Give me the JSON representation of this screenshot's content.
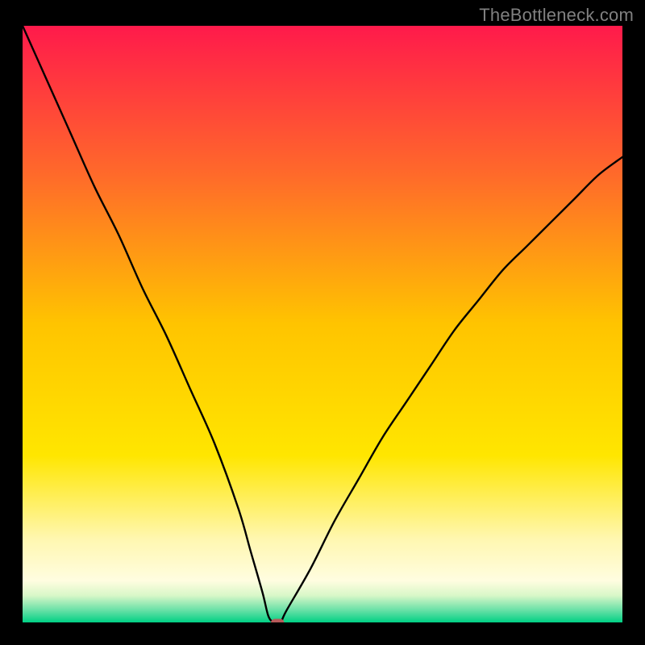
{
  "watermark": "TheBottleneck.com",
  "chart_data": {
    "type": "line",
    "title": "",
    "xlabel": "",
    "ylabel": "",
    "xlim": [
      0,
      100
    ],
    "ylim": [
      0,
      100
    ],
    "grid": false,
    "legend": false,
    "background": {
      "type": "vertical-gradient",
      "stops": [
        {
          "offset": 0.0,
          "color": "#ff1a4b"
        },
        {
          "offset": 0.25,
          "color": "#ff6a2a"
        },
        {
          "offset": 0.5,
          "color": "#ffc400"
        },
        {
          "offset": 0.72,
          "color": "#ffe600"
        },
        {
          "offset": 0.86,
          "color": "#fff7b0"
        },
        {
          "offset": 0.93,
          "color": "#fffde0"
        },
        {
          "offset": 0.955,
          "color": "#d8f7c8"
        },
        {
          "offset": 0.98,
          "color": "#66e0a6"
        },
        {
          "offset": 1.0,
          "color": "#00d084"
        }
      ]
    },
    "series": [
      {
        "name": "bottleneck-curve",
        "x": [
          0,
          4,
          8,
          12,
          16,
          20,
          24,
          28,
          32,
          36,
          38,
          40,
          41,
          42,
          43,
          44,
          48,
          52,
          56,
          60,
          64,
          68,
          72,
          76,
          80,
          84,
          88,
          92,
          96,
          100
        ],
        "y": [
          100,
          91,
          82,
          73,
          65,
          56,
          48,
          39,
          30,
          19,
          12,
          5,
          1,
          0,
          0,
          2,
          9,
          17,
          24,
          31,
          37,
          43,
          49,
          54,
          59,
          63,
          67,
          71,
          75,
          78
        ]
      }
    ],
    "marker": {
      "name": "optimal-point",
      "x": 42.5,
      "y": 0,
      "shape": "rounded-rect",
      "color": "#b65a5a",
      "width_units": 2.2,
      "height_units": 1.2
    }
  }
}
